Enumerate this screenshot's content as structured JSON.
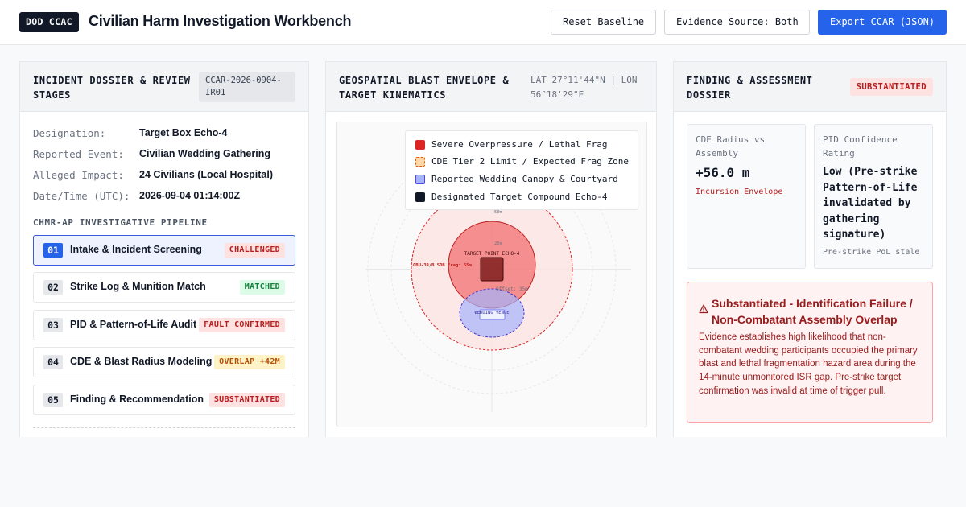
{
  "header": {
    "badge": "DOD CCAC",
    "title": "Civilian Harm Investigation Workbench",
    "reset_label": "Reset Baseline",
    "source_label": "Evidence Source: Both",
    "export_label": "Export CCAR (JSON)"
  },
  "dossier": {
    "title_line1": "INCIDENT DOSSIER & REVIEW",
    "title_line2": "STAGES",
    "case_id_line1": "CCAR-2026-0904-",
    "case_id_line2": "IR01",
    "fields": [
      {
        "label": "Designation:",
        "value": "Target Box Echo-4"
      },
      {
        "label": "Reported Event:",
        "value": "Civilian Wedding Gathering"
      },
      {
        "label": "Alleged Impact:",
        "value": "24 Civilians (Local Hospital)"
      },
      {
        "label": "Date/Time (UTC):",
        "value": "2026-09-04 01:14:00Z"
      }
    ],
    "pipeline_label": "CHMR-AP INVESTIGATIVE PIPELINE",
    "stages": [
      {
        "num": "01",
        "label": "Intake & Incident Screening",
        "status": "CHALLENGED"
      },
      {
        "num": "02",
        "label": "Strike Log & Munition Match",
        "status": "MATCHED"
      },
      {
        "num": "03",
        "label": "PID & Pattern-of-Life Audit",
        "status": "FAULT CONFIRMED"
      },
      {
        "num": "04",
        "label": "CDE & Blast Radius Modeling",
        "status": "OVERLAP +42M"
      },
      {
        "num": "05",
        "label": "Finding & Recommendation",
        "status": "SUBSTANTIATED"
      }
    ]
  },
  "geo": {
    "title_line1": "GEOSPATIAL BLAST ENVELOPE &",
    "title_line2": "TARGET KINEMATICS",
    "lat": "LAT 27°11'44\"N | LON",
    "lon": "56°18'29\"E",
    "legend": [
      {
        "label": "Severe Overpressure / Lethal Frag",
        "color": "#dc2626"
      },
      {
        "label": "CDE Tier 2 Limit / Expected Frag Zone",
        "color": "#fed7aa"
      },
      {
        "label": "Reported Wedding Canopy & Courtyard",
        "color": "#a5b4fc"
      },
      {
        "label": "Designated Target Compound Echo-4",
        "color": "#111827"
      }
    ],
    "ring_50": "50m",
    "ring_25": "25m",
    "target_label": "TARGET POINT ECHO-4",
    "frag_label": "GBU-39/B SDB Frag: 65m",
    "offset_label": "Offset: 35m",
    "wedding_label": "WEDDING VENUE"
  },
  "finding": {
    "title_line1": "FINDING & ASSESSMENT",
    "title_line2": "DOSSIER",
    "badge": "SUBSTANTIATED",
    "metric1": {
      "label": "CDE Radius vs Assembly",
      "value": "+56.0 m",
      "sub": "Incursion Envelope"
    },
    "metric2": {
      "label": "PID Confidence Rating",
      "value": "Low (Pre-strike Pattern-of-Life invalidated by gathering signature)",
      "sub": "Pre-strike PoL stale"
    },
    "alert_title": "Substantiated - Identification Failure / Non-Combatant Assembly Overlap",
    "alert_body": "Evidence establishes high likelihood that non-combatant wedding participants occupied the primary blast and lethal fragmentation hazard area during the 14-minute unmonitored ISR gap. Pre-strike target confirmation was invalid at time of trigger pull."
  }
}
